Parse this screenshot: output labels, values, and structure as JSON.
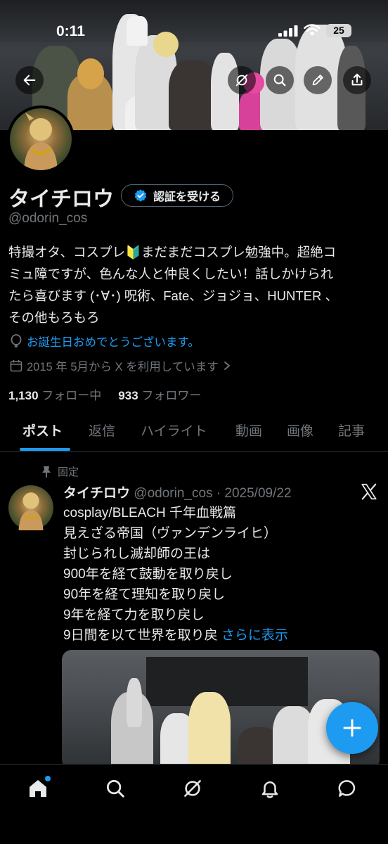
{
  "status_bar": {
    "time": "0:11",
    "battery": "25"
  },
  "profile": {
    "name": "タイチロウ",
    "handle": "@odorin_cos",
    "verify_button": "認証を受ける",
    "bio_lines": [
      "特撮オタ、コスプレ🔰まだまだコスプレ勉強中。超絶コ",
      "ミュ障ですが、色んな人と仲良くしたい！話しかけられ",
      "たら喜びます (･∀･) 呪術、Fate、ジョジョ、HUNTER 、",
      "その他もろもろ"
    ],
    "birthday": "お誕生日おめでとうございます。",
    "joined": "2015 年 5月から X を利用しています",
    "following_count": "1,130",
    "following_label": "フォロー中",
    "followers_count": "933",
    "followers_label": "フォロワー"
  },
  "tabs": [
    "ポスト",
    "返信",
    "ハイライト",
    "動画",
    "画像",
    "記事"
  ],
  "active_tab": "ポスト",
  "post": {
    "pinned_label": "固定",
    "author": "タイチロウ",
    "meta": "@odorin_cos · 2025/09/22",
    "lines": [
      "cosplay/BLEACH 千年血戦篇",
      "見えざる帝国（ヴァンデンライヒ）",
      "封じられし滅却師の王は",
      "900年を経て鼓動を取り戻し",
      "90年を経て理知を取り戻し",
      "9年を経て力を取り戻し",
      "9日間を以て世界を取り戻"
    ],
    "show_more": "さらに表示"
  },
  "colors": {
    "accent": "#1d9bf0",
    "text": "#e7e9ea",
    "muted": "#71767b",
    "background": "#000000"
  },
  "icons": [
    "back-arrow-icon",
    "grok-icon",
    "search-icon",
    "edit-icon",
    "share-icon",
    "verified-badge-icon",
    "balloon-icon",
    "calendar-icon",
    "chevron-right-icon",
    "pin-icon",
    "x-logo-icon",
    "plus-icon",
    "home-icon",
    "explore-icon",
    "grok-nav-icon",
    "notifications-icon",
    "messages-icon"
  ]
}
